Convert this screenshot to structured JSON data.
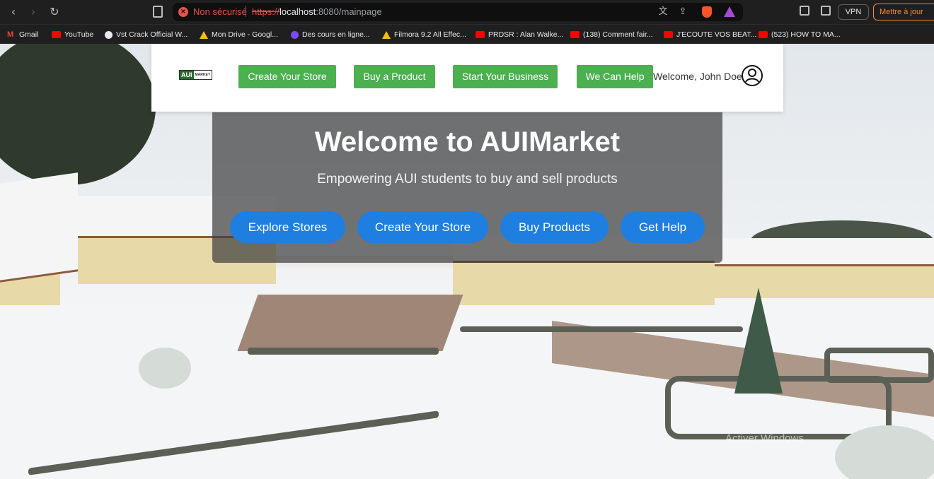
{
  "browser": {
    "security_label": "Non sécurisé",
    "url_scheme": "https://",
    "url_host": "localhost",
    "url_rest": ":8080/mainpage",
    "vpn_label": "VPN",
    "update_label": "Mettre à jour"
  },
  "bookmarks": [
    {
      "label": "Gmail",
      "icon": "gmail-icon"
    },
    {
      "label": "YouTube",
      "icon": "youtube-icon"
    },
    {
      "label": "Vst Crack Official W...",
      "icon": "github-icon"
    },
    {
      "label": "Mon Drive - Googl...",
      "icon": "drive-icon"
    },
    {
      "label": "Des cours en ligne...",
      "icon": "course-icon"
    },
    {
      "label": "Filmora 9.2 All Effec...",
      "icon": "drive-icon"
    },
    {
      "label": "PRDSR : Alan Walke...",
      "icon": "youtube-icon"
    },
    {
      "label": "(138) Comment fair...",
      "icon": "youtube-icon"
    },
    {
      "label": "J'ECOUTE VOS BEAT...",
      "icon": "youtube-icon"
    },
    {
      "label": "(523) HOW TO MA...",
      "icon": "youtube-icon"
    }
  ],
  "header": {
    "logo_main": "AUI",
    "logo_sub": "MARKET",
    "nav": [
      {
        "label": "Create Your Store"
      },
      {
        "label": "Buy a Product"
      },
      {
        "label": "Start Your Business"
      },
      {
        "label": "We Can Help"
      }
    ],
    "welcome": "Welcome, John Doe"
  },
  "hero": {
    "title": "Welcome to AUIMarket",
    "subtitle": "Empowering AUI students to buy and sell products",
    "buttons": [
      {
        "label": "Explore Stores"
      },
      {
        "label": "Create Your Store"
      },
      {
        "label": "Buy Products"
      },
      {
        "label": "Get Help"
      }
    ]
  },
  "overlay": {
    "activate_windows": "Activer Windows"
  },
  "colors": {
    "nav_green": "#4caf50",
    "hero_blue": "#1e7fe0",
    "insecure_red": "#e5534b"
  }
}
